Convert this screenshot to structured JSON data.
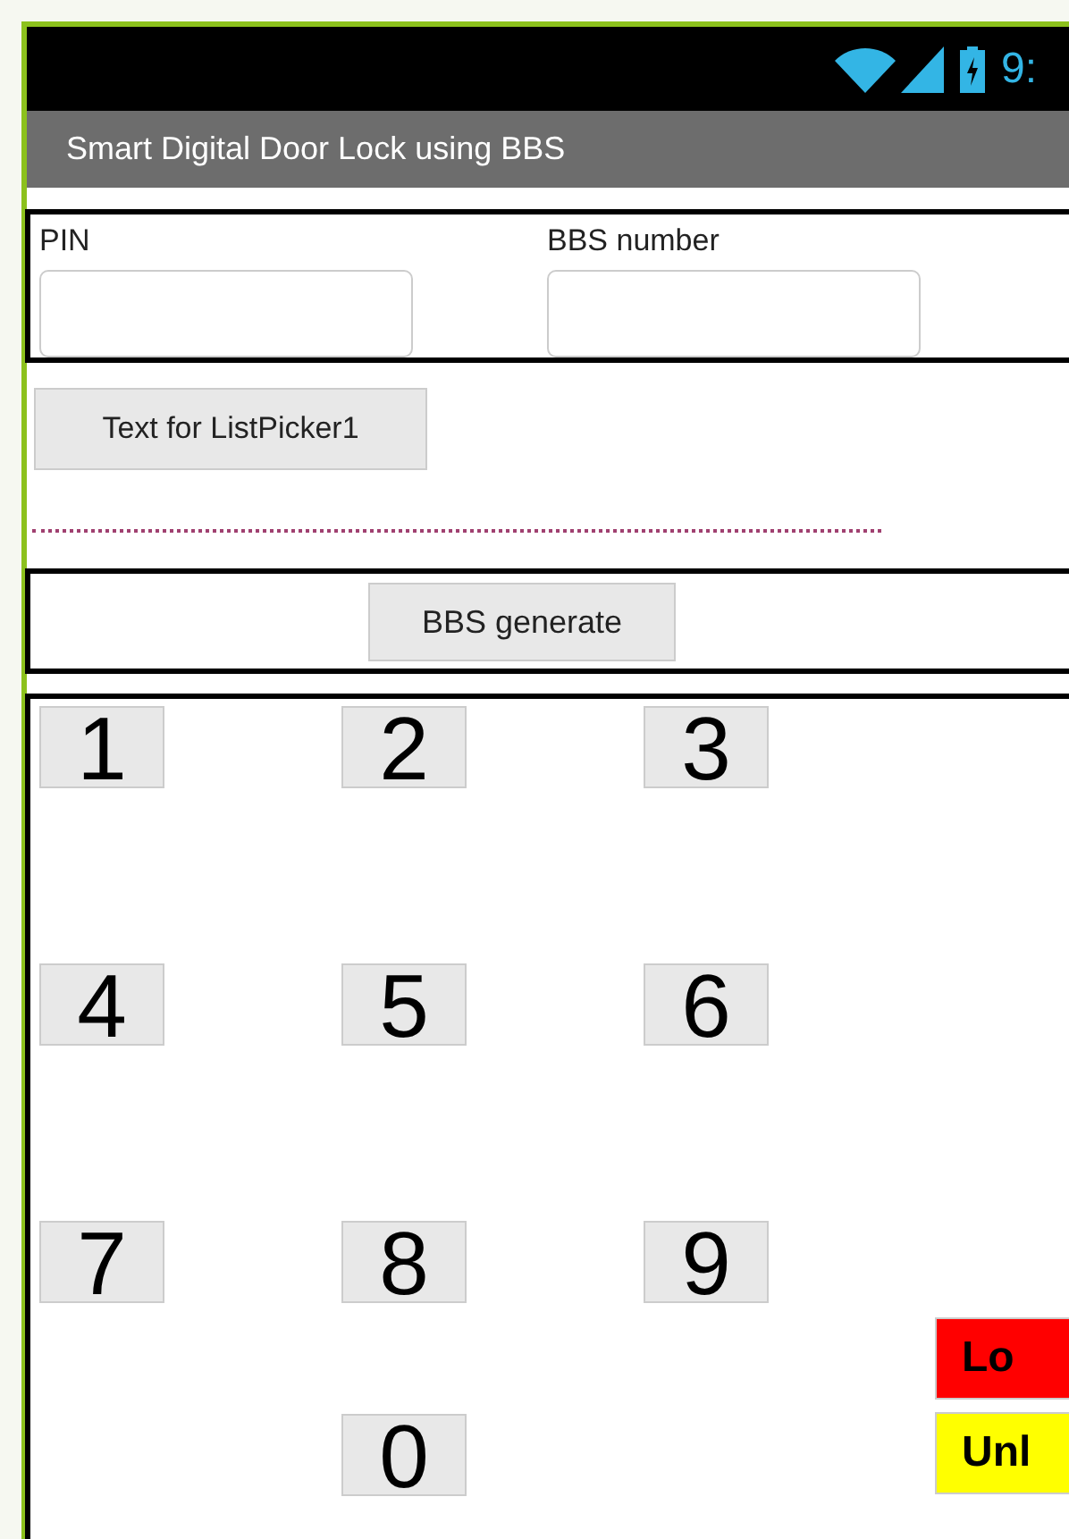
{
  "status_bar": {
    "time": "9:"
  },
  "title": "Smart Digital Door Lock using BBS",
  "fields": [
    {
      "label": "PIN"
    },
    {
      "label": "BBS number"
    }
  ],
  "list_picker": {
    "label": "Text for ListPicker1"
  },
  "generate_button": {
    "label": "BBS generate"
  },
  "keypad": {
    "keys": [
      "1",
      "2",
      "3",
      "4",
      "5",
      "6",
      "7",
      "8",
      "9",
      "0"
    ]
  },
  "lock_buttons": [
    {
      "label": "Lo",
      "color": "#ff0000"
    },
    {
      "label": "Unl",
      "color": "#ffff00"
    }
  ]
}
